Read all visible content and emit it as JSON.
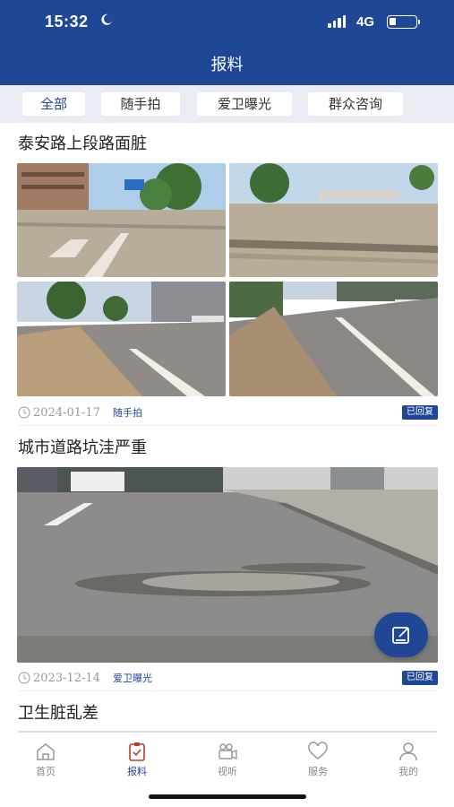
{
  "status_bar": {
    "time": "15:32",
    "network": "4G"
  },
  "header": {
    "title": "报料"
  },
  "tabs": [
    {
      "label": "全部"
    },
    {
      "label": "随手拍"
    },
    {
      "label": "爱卫曝光"
    },
    {
      "label": "群众咨询"
    }
  ],
  "posts": [
    {
      "title": "泰安路上段路面脏",
      "date": "2024-01-17",
      "category": "随手拍",
      "status": "已回复"
    },
    {
      "title": "城市道路坑洼严重",
      "date": "2023-12-14",
      "category": "爱卫曝光",
      "status": "已回复"
    },
    {
      "title": "卫生脏乱差"
    }
  ],
  "bottom_nav": [
    {
      "label": "首页",
      "icon": "home-icon"
    },
    {
      "label": "报料",
      "icon": "report-icon"
    },
    {
      "label": "视听",
      "icon": "camera-icon"
    },
    {
      "label": "服务",
      "icon": "heart-icon"
    },
    {
      "label": "我的",
      "icon": "user-icon"
    }
  ],
  "colors": {
    "primary": "#1f4796",
    "tab_bar_bg": "#eaedf3"
  },
  "icons": {
    "fab": "edit-icon",
    "clock": "clock-icon"
  }
}
